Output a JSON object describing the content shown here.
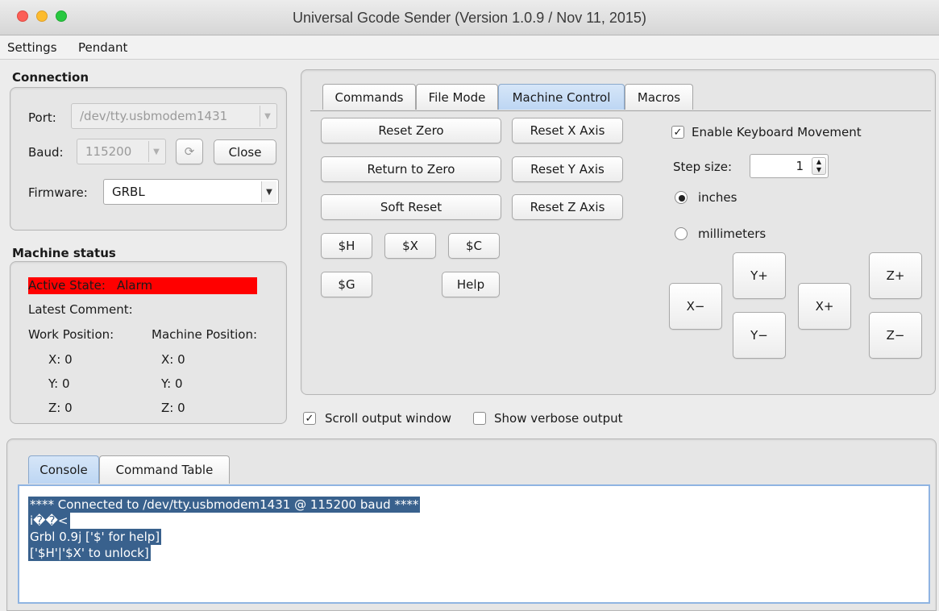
{
  "window": {
    "title": "Universal Gcode Sender (Version 1.0.9 / Nov 11, 2015)"
  },
  "menu": {
    "items": [
      "Settings",
      "Pendant"
    ]
  },
  "connection": {
    "title": "Connection",
    "port_label": "Port:",
    "port_value": "/dev/tty.usbmodem1431",
    "baud_label": "Baud:",
    "baud_value": "115200",
    "refresh_glyph": "⟳",
    "close_label": "Close",
    "firmware_label": "Firmware:",
    "firmware_value": "GRBL"
  },
  "machine_status": {
    "title": "Machine status",
    "active_state_label": "Active State:",
    "active_state_value": "Alarm",
    "latest_comment_label": "Latest Comment:",
    "work_position_label": "Work Position:",
    "machine_position_label": "Machine Position:",
    "work": {
      "x": "X:  0",
      "y": "Y:  0",
      "z": "Z:  0"
    },
    "machine": {
      "x": "X:  0",
      "y": "Y:  0",
      "z": "Z:  0"
    }
  },
  "tabs": [
    "Commands",
    "File Mode",
    "Machine Control",
    "Macros"
  ],
  "machine_control": {
    "reset_zero": "Reset Zero",
    "return_to_zero": "Return to Zero",
    "soft_reset": "Soft Reset",
    "reset_x": "Reset X Axis",
    "reset_y": "Reset Y Axis",
    "reset_z": "Reset Z Axis",
    "cmd_h": "$H",
    "cmd_x": "$X",
    "cmd_c": "$C",
    "cmd_g": "$G",
    "help": "Help",
    "enable_keyboard": "Enable Keyboard Movement",
    "step_size_label": "Step size:",
    "step_size_value": "1",
    "unit_inches": "inches",
    "unit_mm": "millimeters",
    "jog": {
      "y_plus": "Y+",
      "y_minus": "Y−",
      "x_minus": "X−",
      "x_plus": "X+",
      "z_plus": "Z+",
      "z_minus": "Z−"
    }
  },
  "options": {
    "scroll_output": "Scroll output window",
    "verbose_output": "Show verbose output"
  },
  "bottom_tabs": [
    "Console",
    "Command Table"
  ],
  "console_lines": [
    "**** Connected to /dev/tty.usbmodem1431 @ 115200 baud ****",
    "i��<",
    "Grbl 0.9j ['$' for help]",
    "['$H'|'$X' to unlock]"
  ]
}
